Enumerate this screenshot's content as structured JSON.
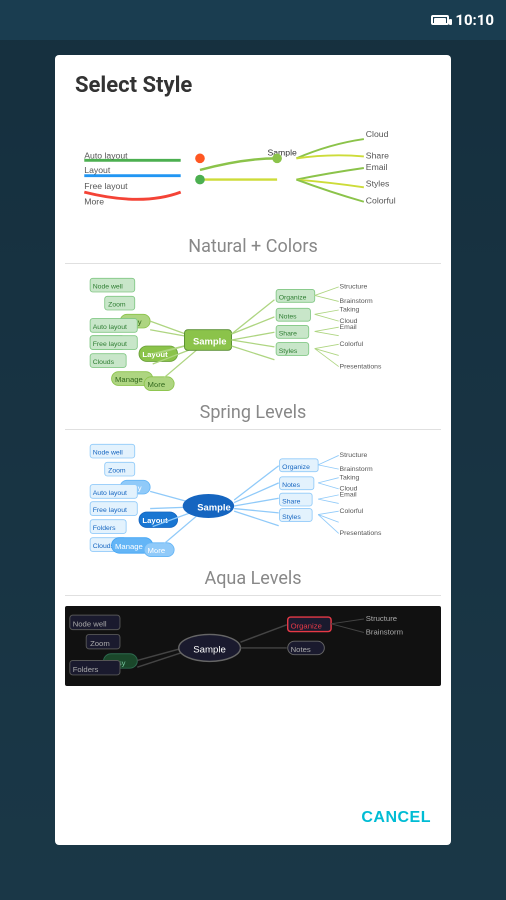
{
  "statusBar": {
    "time": "10:10"
  },
  "dialog": {
    "title": "Select Style",
    "cancelLabel": "CANCEL",
    "styles": [
      {
        "id": "natural-colors",
        "label": "Natural + Colors"
      },
      {
        "id": "spring-levels",
        "label": "Spring Levels"
      },
      {
        "id": "aqua-levels",
        "label": "Aqua Levels"
      }
    ]
  }
}
